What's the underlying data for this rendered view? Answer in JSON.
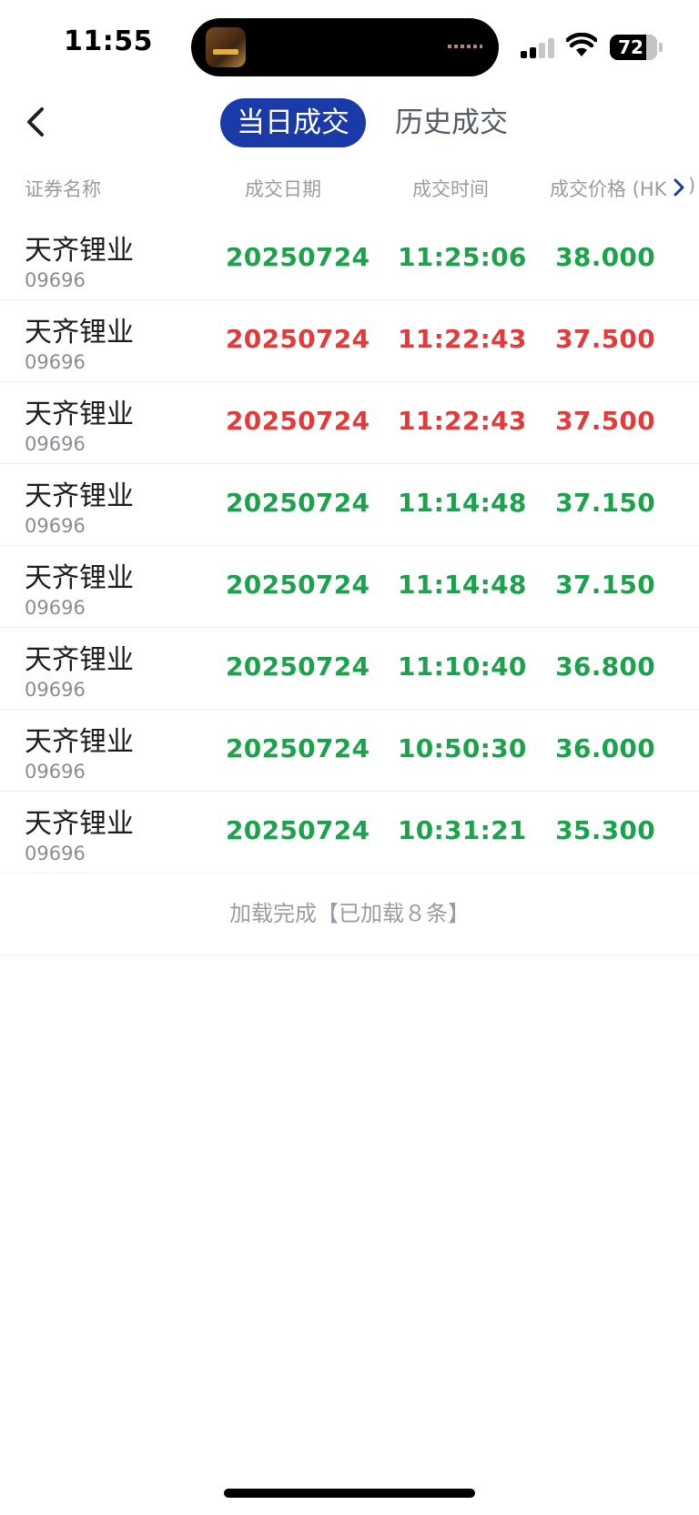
{
  "status_bar": {
    "time": "11:55",
    "battery": "72"
  },
  "nav": {
    "tabs": [
      {
        "label": "当日成交",
        "active": true
      },
      {
        "label": "历史成交",
        "active": false
      }
    ]
  },
  "table": {
    "headers": {
      "name": "证券名称",
      "date": "成交日期",
      "time": "成交时间",
      "price": "成交价格 (HK",
      "price_tail": ")"
    },
    "rows": [
      {
        "name": "天齐锂业",
        "code": "09696",
        "date": "20250724",
        "time": "11:25:06",
        "price": "38.000",
        "direction": "down"
      },
      {
        "name": "天齐锂业",
        "code": "09696",
        "date": "20250724",
        "time": "11:22:43",
        "price": "37.500",
        "direction": "up"
      },
      {
        "name": "天齐锂业",
        "code": "09696",
        "date": "20250724",
        "time": "11:22:43",
        "price": "37.500",
        "direction": "up"
      },
      {
        "name": "天齐锂业",
        "code": "09696",
        "date": "20250724",
        "time": "11:14:48",
        "price": "37.150",
        "direction": "down"
      },
      {
        "name": "天齐锂业",
        "code": "09696",
        "date": "20250724",
        "time": "11:14:48",
        "price": "37.150",
        "direction": "down"
      },
      {
        "name": "天齐锂业",
        "code": "09696",
        "date": "20250724",
        "time": "11:10:40",
        "price": "36.800",
        "direction": "down"
      },
      {
        "name": "天齐锂业",
        "code": "09696",
        "date": "20250724",
        "time": "10:50:30",
        "price": "36.000",
        "direction": "down"
      },
      {
        "name": "天齐锂业",
        "code": "09696",
        "date": "20250724",
        "time": "10:31:21",
        "price": "35.300",
        "direction": "down"
      }
    ],
    "footer": "加载完成【已加载８条】"
  },
  "colors": {
    "up": "#e63a3a",
    "down": "#1aa34a",
    "accent": "#1a3aa8"
  },
  "icons": {
    "back": "chevron-left-icon",
    "scroll": "chevron-right-icon"
  }
}
